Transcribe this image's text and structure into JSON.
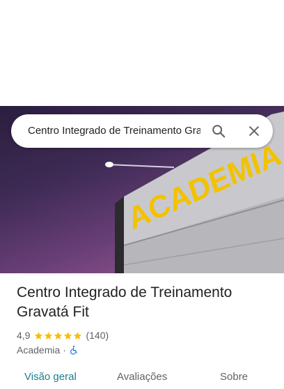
{
  "search": {
    "query": "Centro Integrado de Treinamento Gravatá Fit",
    "search_icon": "search-icon",
    "close_icon": "close-icon"
  },
  "hero": {
    "sign_text": "ACADEMIA"
  },
  "place": {
    "name": "Centro Integrado de Treinamento Gravatá Fit",
    "rating": "4,9",
    "stars": 5,
    "review_count": "(140)",
    "category": "Academia",
    "separator": "·",
    "accessibility_icon": "wheelchair-accessible-icon"
  },
  "tabs": [
    {
      "label": "Visão geral",
      "active": true
    },
    {
      "label": "Avaliações",
      "active": false
    },
    {
      "label": "Sobre",
      "active": false
    }
  ],
  "colors": {
    "accent": "#1a7f8c",
    "star": "#fbbc04",
    "sign": "#f2c200",
    "access": "#1a73e8"
  }
}
